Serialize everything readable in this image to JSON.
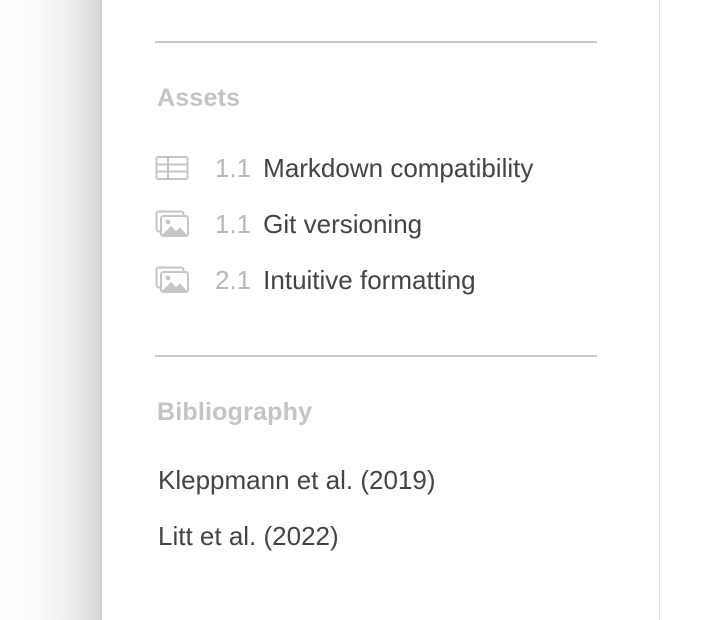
{
  "assets": {
    "title": "Assets",
    "items": [
      {
        "icon": "table-icon",
        "number": "1.1",
        "label": "Markdown compatibility"
      },
      {
        "icon": "image-icon",
        "number": "1.1",
        "label": "Git versioning"
      },
      {
        "icon": "image-icon",
        "number": "2.1",
        "label": "Intuitive formatting"
      }
    ]
  },
  "bibliography": {
    "title": "Bibliography",
    "items": [
      "Kleppmann et al. (2019)",
      "Litt et al. (2022)"
    ]
  },
  "colors": {
    "section_title": "#c4c4c4",
    "label_text": "#444444",
    "number_text": "#b9b9b9",
    "icon": "#c6c6c6",
    "divider": "#c9c9c9"
  }
}
